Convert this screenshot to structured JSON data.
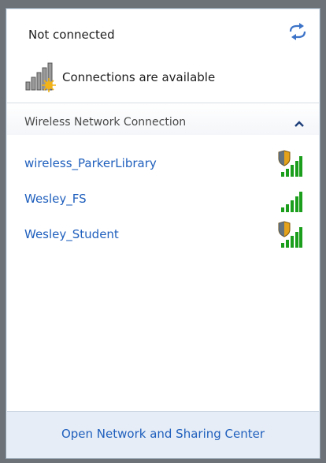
{
  "status": {
    "title": "Not connected",
    "connections_text": "Connections are available"
  },
  "section": {
    "title": "Wireless Network Connection"
  },
  "networks": [
    {
      "name": "wireless_ParkerLibrary",
      "secured": true
    },
    {
      "name": "Wesley_FS",
      "secured": false
    },
    {
      "name": "Wesley_Student",
      "secured": true
    }
  ],
  "footer": {
    "link": "Open Network and Sharing Center"
  },
  "colors": {
    "link": "#1f5fbd",
    "signal": "#1b9e1b",
    "shield": "#e3a21a"
  },
  "icons": {
    "refresh": "refresh-icon",
    "no-connection": "signal-bars-warning-icon",
    "collapse": "chevron-up-icon",
    "secured-signal": "signal-bars-shield-icon",
    "signal": "signal-bars-icon"
  }
}
